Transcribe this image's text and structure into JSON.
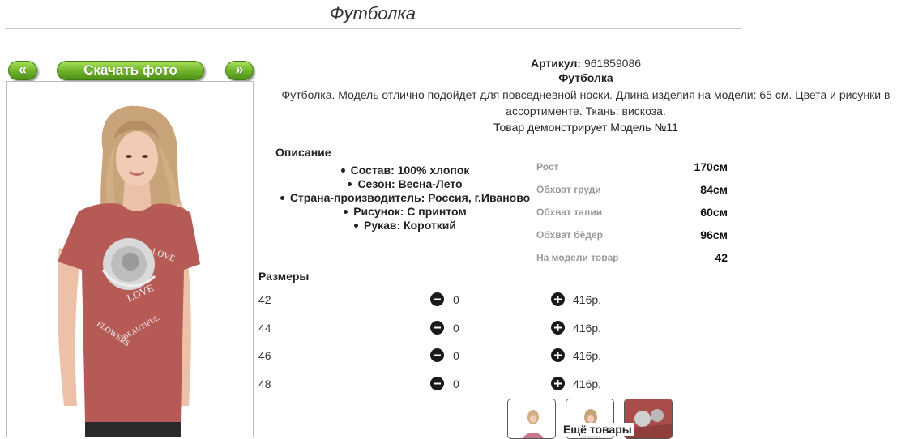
{
  "page": {
    "title": "Футболка"
  },
  "gallery": {
    "prev_label": "«",
    "download_label": "Скачать фото",
    "next_label": "»"
  },
  "product": {
    "article_label": "Артикул:",
    "article_value": "961859086",
    "name": "Футболка",
    "description": "Футболка. Модель отлично подойдет для повседневной носки. Длина изделия на модели: 65 см. Цвета и рисунки в ассортименте. Ткань: вискоза.",
    "model_note": "Товар демонстрирует Модель №11"
  },
  "features": {
    "heading": "Описание",
    "items": [
      "Состав: 100% хлопок",
      "Сезон: Весна-Лето",
      "Страна-производитель: Россия, г.Иваново",
      "Рисунок: С принтом",
      "Рукав: Короткий"
    ]
  },
  "measurements": [
    {
      "label": "Рост",
      "value": "170см"
    },
    {
      "label": "Обхват груди",
      "value": "84см"
    },
    {
      "label": "Обхват талии",
      "value": "60см"
    },
    {
      "label": "Обхват бёдер",
      "value": "96см"
    },
    {
      "label": "На модели товар",
      "value": "42"
    }
  ],
  "sizes": {
    "heading": "Размеры",
    "rows": [
      {
        "size": "42",
        "qty": "0",
        "price": "416р."
      },
      {
        "size": "44",
        "qty": "0",
        "price": "416р."
      },
      {
        "size": "46",
        "qty": "0",
        "price": "416р."
      },
      {
        "size": "48",
        "qty": "0",
        "price": "416р."
      }
    ]
  },
  "more": {
    "label": "Ещё товары"
  },
  "colors": {
    "accent_green": "#6db22a",
    "shirt": "#b65a56",
    "icon_dark": "#1a1a1a"
  }
}
